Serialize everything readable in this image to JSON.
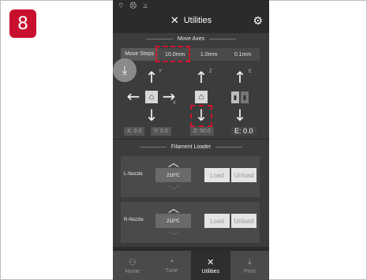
{
  "step_number": "8",
  "status_icons": "⌔ ☹ ⊻",
  "title": "Utilities",
  "move_axes": {
    "section_title": "Move Axes",
    "steps_label": "Move Steps",
    "steps": [
      "10.0mm",
      "1.0mm",
      "0.1mm"
    ],
    "axis_y": "Y",
    "axis_x": "X",
    "axis_z": "Z",
    "axis_e": "E",
    "coords": {
      "x": "X: 0.0",
      "y": "Y: 0.0",
      "z": "Z: 50.0",
      "e": "E: 0.0"
    }
  },
  "filament_loader": {
    "section_title": "Filament Loader",
    "nozzles": [
      {
        "name": "L-Nozzle",
        "temp": "210℃",
        "load": "Load",
        "unload": "Unload"
      },
      {
        "name": "R-Nozzle",
        "temp": "210℃",
        "load": "Load",
        "unload": "Unload"
      }
    ]
  },
  "nav": [
    {
      "label": "Home",
      "icon": "people-icon"
    },
    {
      "label": "Tune",
      "icon": "dial-icon"
    },
    {
      "label": "Utilities",
      "icon": "tools-icon"
    },
    {
      "label": "Print",
      "icon": "download-icon"
    }
  ],
  "colors": {
    "highlight": "#d0142c",
    "badge": "#c8102e",
    "panel": "#3c3c3c"
  }
}
